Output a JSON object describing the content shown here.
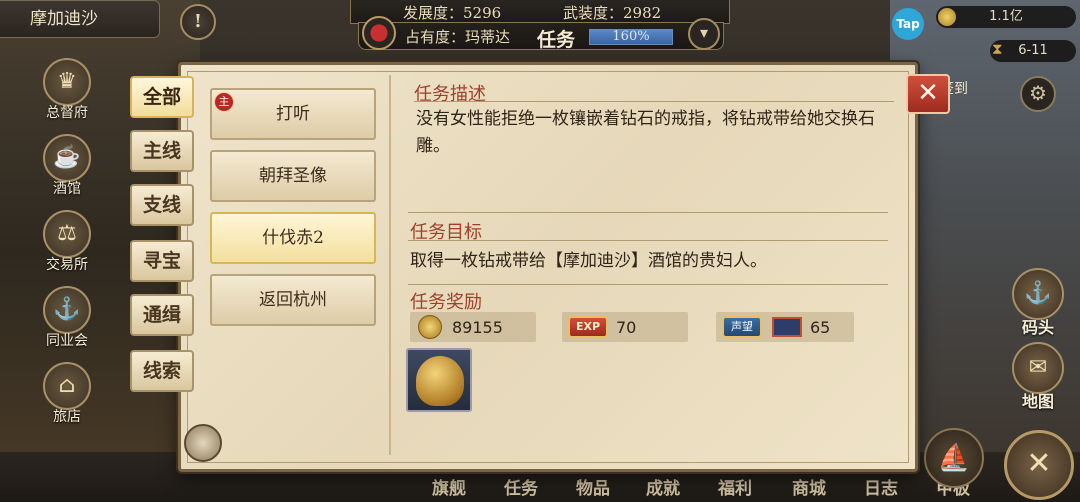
{
  "city": "摩加迪沙",
  "top_stats": {
    "development_label": "发展度：5296",
    "armament_label": "武装度：2982",
    "occupancy_label": "占有度：玛蒂达",
    "task_title": "任务",
    "progress_text": "160%",
    "progress_fraction": 1.0
  },
  "top_right": {
    "tap_label": "Tap",
    "gold": "1.1亿",
    "date": "6-11",
    "signin": "签到"
  },
  "left_nav": [
    {
      "label": "总督府",
      "icon": "crown-icon"
    },
    {
      "label": "酒馆",
      "icon": "tavern-icon"
    },
    {
      "label": "交易所",
      "icon": "scales-icon"
    },
    {
      "label": "同业会",
      "icon": "guild-shield-icon"
    },
    {
      "label": "旅店",
      "icon": "inn-icon"
    }
  ],
  "right_nav": [
    {
      "label": "码头",
      "icon": "dock-icon"
    },
    {
      "label": "地图",
      "icon": "map-icon"
    }
  ],
  "bottom_nav": [
    "旗舰",
    "任务",
    "物品",
    "成就",
    "福利",
    "商城",
    "日志",
    "甲板"
  ],
  "categories": [
    "全部",
    "主线",
    "支线",
    "寻宝",
    "通缉",
    "线索"
  ],
  "active_category": "全部",
  "quests": [
    {
      "name": "打听",
      "badge": "主"
    },
    {
      "name": "朝拜圣像"
    },
    {
      "name": "什伐赤2"
    },
    {
      "name": "返回杭州"
    }
  ],
  "active_quest": "什伐赤2",
  "detail": {
    "desc_title": "任务描述",
    "desc_text": "没有女性能拒绝一枚镶嵌着钻石的戒指，将钻戒带给她交换石雕。",
    "goal_title": "任务目标",
    "goal_text": "取得一枚钻戒带给【摩加迪沙】酒馆的贵妇人。",
    "reward_title": "任务奖励",
    "rewards": {
      "gold": "89155",
      "exp_label": "EXP",
      "exp": "70",
      "rep_label": "声望",
      "rep": "65"
    },
    "item_icon": "golden-lion-statue-icon"
  },
  "colors": {
    "title_red": "#a0402a",
    "parchment": "#efe4cb",
    "close_red": "#c84535",
    "progress_blue": "#3a64a0"
  }
}
